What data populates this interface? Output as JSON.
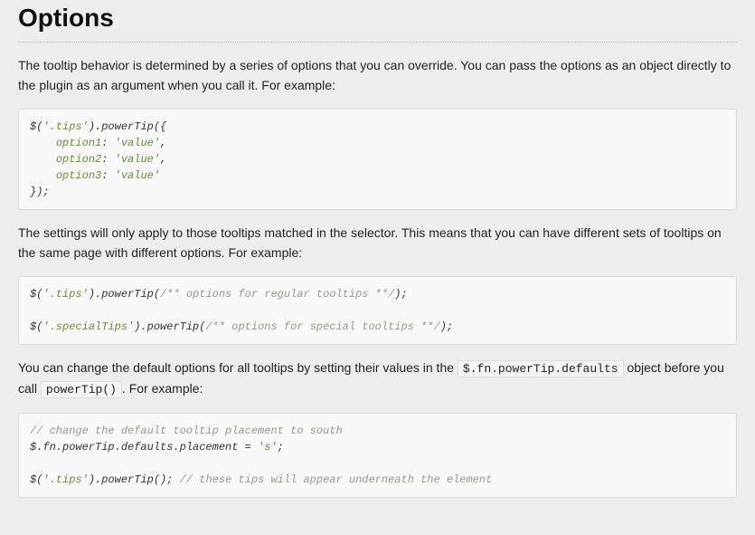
{
  "heading": "Options",
  "para1": "The tooltip behavior is determined by a series of options that you can override. You can pass the options as an object directly to the plugin as an argument when you call it. For example:",
  "code1_l1a": "$(",
  "code1_l1b": "'.tips'",
  "code1_l1c": ").powerTip({",
  "code1_l2a": "    ",
  "code1_l2b": "option1",
  "code1_l2c": ": ",
  "code1_l2d": "'value'",
  "code1_l2e": ",",
  "code1_l3a": "    ",
  "code1_l3b": "option2",
  "code1_l3c": ": ",
  "code1_l3d": "'value'",
  "code1_l3e": ",",
  "code1_l4a": "    ",
  "code1_l4b": "option3",
  "code1_l4c": ": ",
  "code1_l4d": "'value'",
  "code1_l5": "});",
  "para2": "The settings will only apply to those tooltips matched in the selector. This means that you can have different sets of tooltips on the same page with different options. For example:",
  "code2_l1a": "$(",
  "code2_l1b": "'.tips'",
  "code2_l1c": ").powerTip(",
  "code2_l1d": "/** options for regular tooltips **/",
  "code2_l1e": ");",
  "code2_l2a": "$(",
  "code2_l2b": "'.specialTips'",
  "code2_l2c": ").powerTip(",
  "code2_l2d": "/** options for special tooltips **/",
  "code2_l2e": ");",
  "para3a": "You can change the default options for all tooltips by setting their values in the ",
  "para3code1": "$.fn.powerTip.defaults",
  "para3b": " object before you call ",
  "para3code2": "powerTip()",
  "para3c": ". For example:",
  "code3_l1": "// change the default tooltip placement to south",
  "code3_l2a": "$.fn.powerTip.defaults.placement = ",
  "code3_l2b": "'s'",
  "code3_l2c": ";",
  "code3_l3a": "$(",
  "code3_l3b": "'.tips'",
  "code3_l3c": ").powerTip(); ",
  "code3_l3d": "// these tips will appear underneath the element"
}
